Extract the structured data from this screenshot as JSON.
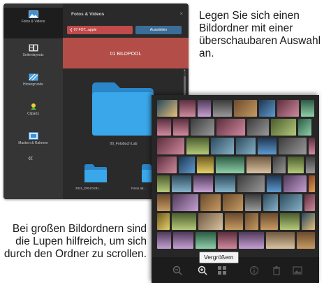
{
  "captions": {
    "top": "Legen Sie sich einen Bildordner mit einer überschaubaren Auswahl an.",
    "bottom": "Bei großen Bildordnern sind die Lupen hilfreich, um sich durch den Ordner zu scrollen."
  },
  "window1": {
    "sidebar": {
      "items": [
        {
          "label": "Fotos & Videos",
          "icon": "photos-icon"
        },
        {
          "label": "Seitenlayouts",
          "icon": "layouts-icon"
        },
        {
          "label": "Hintergründe",
          "icon": "backgrounds-icon"
        },
        {
          "label": "Cliparts",
          "icon": "cliparts-icon"
        },
        {
          "label": "Masken & Rahmen",
          "icon": "masks-frames-icon"
        }
      ],
      "collapse": "«"
    },
    "panel": {
      "title": "Fotos & Videos",
      "close": "×",
      "path_button": "❮ 07 FOT...apple",
      "select_button": "Auswählen",
      "pool_label": "01 BILDPOOL",
      "folders": [
        "00_Fotobuch Lab",
        "2021_DRUCKBI...",
        "Fotos alt..."
      ]
    }
  },
  "window2": {
    "tooltip": "Vergrößern",
    "bottom_icons": [
      "zoom-out-icon",
      "zoom-in-icon",
      "grid-icon",
      "info-icon",
      "trash-icon",
      "picture-icon"
    ],
    "selected": "zoom-in-icon"
  },
  "colors": {
    "path_button": "#c14a4a",
    "select_button": "#3c6d97",
    "pool_header": "#b24e47",
    "folder": "#2f9be0"
  }
}
